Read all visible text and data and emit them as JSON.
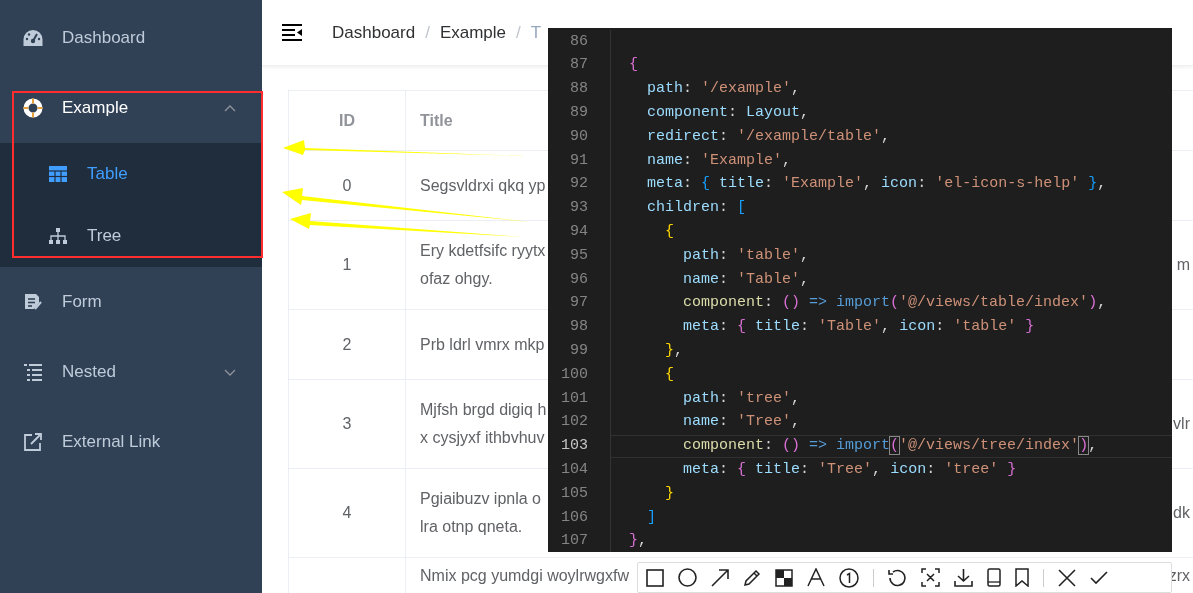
{
  "sidebar": {
    "items": [
      {
        "label": "Dashboard",
        "selected": false
      },
      {
        "label": "Example",
        "selected": false,
        "expanded": true,
        "children": [
          {
            "label": "Table",
            "selected": true
          },
          {
            "label": "Tree",
            "selected": false
          }
        ]
      },
      {
        "label": "Form",
        "selected": false
      },
      {
        "label": "Nested",
        "selected": false,
        "expanded": false
      },
      {
        "label": "External Link",
        "selected": false
      }
    ]
  },
  "breadcrumb": {
    "items": [
      "Dashboard",
      "Example",
      "T"
    ],
    "separators": [
      "/",
      "/"
    ]
  },
  "table": {
    "columns": [
      "ID",
      "Title"
    ],
    "rows": [
      {
        "id": "0",
        "title_lines": [
          "Segsvldrxi qkq yp"
        ]
      },
      {
        "id": "1",
        "title_lines": [
          "Ery kdetfsifc ryytx",
          "ofaz ohgy."
        ],
        "title_end": "m"
      },
      {
        "id": "2",
        "title_lines": [
          "Prb ldrl vmrx mkp"
        ]
      },
      {
        "id": "3",
        "title_lines": [
          "Mjfsh brgd digiq h",
          "x cysjyxf ithbvhuv"
        ],
        "title_end": "vlr"
      },
      {
        "id": "4",
        "title_lines": [
          "Pgiaibuzv ipnla o",
          "lra otnp qneta."
        ],
        "title_end": "dk"
      },
      {
        "title_lines": [
          "Nmix pcg yumdgi woylrwgxfw"
        ],
        "title_end": "zrx"
      }
    ]
  },
  "code_editor": {
    "lines": [
      {
        "number": "86",
        "highlighted": false
      },
      {
        "number": "87",
        "highlighted": false,
        "tokens": [
          {
            "kind": "b2",
            "text": "  {"
          }
        ]
      },
      {
        "number": "88",
        "highlighted": false,
        "tokens": [
          {
            "kind": "key",
            "text": "    path"
          },
          {
            "kind": "punc",
            "text": ": "
          },
          {
            "kind": "str",
            "text": "'/example'"
          },
          {
            "kind": "punc",
            "text": ","
          }
        ]
      },
      {
        "number": "89",
        "highlighted": false,
        "tokens": [
          {
            "kind": "key",
            "text": "    component"
          },
          {
            "kind": "punc",
            "text": ": "
          },
          {
            "kind": "var",
            "text": "Layout"
          },
          {
            "kind": "punc",
            "text": ","
          }
        ]
      },
      {
        "number": "90",
        "highlighted": false,
        "tokens": [
          {
            "kind": "key",
            "text": "    redirect"
          },
          {
            "kind": "punc",
            "text": ": "
          },
          {
            "kind": "str",
            "text": "'/example/table'"
          },
          {
            "kind": "punc",
            "text": ","
          }
        ]
      },
      {
        "number": "91",
        "highlighted": false,
        "tokens": [
          {
            "kind": "key",
            "text": "    name"
          },
          {
            "kind": "punc",
            "text": ": "
          },
          {
            "kind": "str",
            "text": "'Example'"
          },
          {
            "kind": "punc",
            "text": ","
          }
        ]
      },
      {
        "number": "92",
        "highlighted": false,
        "tokens": [
          {
            "kind": "key",
            "text": "    meta"
          },
          {
            "kind": "punc",
            "text": ": "
          },
          {
            "kind": "b3",
            "text": "{"
          },
          {
            "kind": "key",
            "text": " title"
          },
          {
            "kind": "punc",
            "text": ": "
          },
          {
            "kind": "str",
            "text": "'Example'"
          },
          {
            "kind": "punc",
            "text": ", "
          },
          {
            "kind": "key",
            "text": "icon"
          },
          {
            "kind": "punc",
            "text": ": "
          },
          {
            "kind": "str",
            "text": "'el-icon-s-help'"
          },
          {
            "kind": "b3",
            "text": " }"
          },
          {
            "kind": "punc",
            "text": ","
          }
        ]
      },
      {
        "number": "93",
        "highlighted": false,
        "tokens": [
          {
            "kind": "key",
            "text": "    children"
          },
          {
            "kind": "punc",
            "text": ": "
          },
          {
            "kind": "b3",
            "text": "["
          }
        ]
      },
      {
        "number": "94",
        "highlighted": false,
        "tokens": [
          {
            "kind": "b1",
            "text": "      {"
          }
        ]
      },
      {
        "number": "95",
        "highlighted": false,
        "tokens": [
          {
            "kind": "key",
            "text": "        path"
          },
          {
            "kind": "punc",
            "text": ": "
          },
          {
            "kind": "str",
            "text": "'table'"
          },
          {
            "kind": "punc",
            "text": ","
          }
        ]
      },
      {
        "number": "96",
        "highlighted": false,
        "tokens": [
          {
            "kind": "key",
            "text": "        name"
          },
          {
            "kind": "punc",
            "text": ": "
          },
          {
            "kind": "str",
            "text": "'Table'"
          },
          {
            "kind": "punc",
            "text": ","
          }
        ]
      },
      {
        "number": "97",
        "highlighted": false,
        "tokens": [
          {
            "kind": "fn",
            "text": "        component"
          },
          {
            "kind": "punc",
            "text": ": "
          },
          {
            "kind": "b2",
            "text": "()"
          },
          {
            "kind": "kw",
            "text": " => import"
          },
          {
            "kind": "b2",
            "text": "("
          },
          {
            "kind": "str",
            "text": "'@/views/table/index'"
          },
          {
            "kind": "b2",
            "text": ")"
          },
          {
            "kind": "punc",
            "text": ","
          }
        ]
      },
      {
        "number": "98",
        "highlighted": false,
        "tokens": [
          {
            "kind": "key",
            "text": "        meta"
          },
          {
            "kind": "punc",
            "text": ": "
          },
          {
            "kind": "b2",
            "text": "{"
          },
          {
            "kind": "key",
            "text": " title"
          },
          {
            "kind": "punc",
            "text": ": "
          },
          {
            "kind": "str",
            "text": "'Table'"
          },
          {
            "kind": "punc",
            "text": ", "
          },
          {
            "kind": "key",
            "text": "icon"
          },
          {
            "kind": "punc",
            "text": ": "
          },
          {
            "kind": "str",
            "text": "'table'"
          },
          {
            "kind": "b2",
            "text": " }"
          }
        ]
      },
      {
        "number": "99",
        "highlighted": false,
        "tokens": [
          {
            "kind": "b1",
            "text": "      }"
          },
          {
            "kind": "punc",
            "text": ","
          }
        ]
      },
      {
        "number": "100",
        "highlighted": false,
        "tokens": [
          {
            "kind": "b1",
            "text": "      {"
          }
        ]
      },
      {
        "number": "101",
        "highlighted": false,
        "tokens": [
          {
            "kind": "key",
            "text": "        path"
          },
          {
            "kind": "punc",
            "text": ": "
          },
          {
            "kind": "str",
            "text": "'tree'"
          },
          {
            "kind": "punc",
            "text": ","
          }
        ]
      },
      {
        "number": "102",
        "highlighted": false,
        "tokens": [
          {
            "kind": "key",
            "text": "        name"
          },
          {
            "kind": "punc",
            "text": ": "
          },
          {
            "kind": "str",
            "text": "'Tree'"
          },
          {
            "kind": "punc",
            "text": ","
          }
        ]
      },
      {
        "number": "103",
        "highlighted": true,
        "tokens": [
          {
            "kind": "fn",
            "text": "        component"
          },
          {
            "kind": "punc",
            "text": ": "
          },
          {
            "kind": "b2",
            "text": "()"
          },
          {
            "kind": "kw",
            "text": " => import"
          },
          {
            "kind": "match",
            "text": "("
          },
          {
            "kind": "str",
            "text": "'@/views/tree/index'"
          },
          {
            "kind": "match",
            "text": ")"
          },
          {
            "kind": "punc",
            "text": ","
          }
        ]
      },
      {
        "number": "104",
        "highlighted": false,
        "tokens": [
          {
            "kind": "key",
            "text": "        meta"
          },
          {
            "kind": "punc",
            "text": ": "
          },
          {
            "kind": "b2",
            "text": "{"
          },
          {
            "kind": "key",
            "text": " title"
          },
          {
            "kind": "punc",
            "text": ": "
          },
          {
            "kind": "str",
            "text": "'Tree'"
          },
          {
            "kind": "punc",
            "text": ", "
          },
          {
            "kind": "key",
            "text": "icon"
          },
          {
            "kind": "punc",
            "text": ": "
          },
          {
            "kind": "str",
            "text": "'tree'"
          },
          {
            "kind": "b2",
            "text": " }"
          }
        ]
      },
      {
        "number": "105",
        "highlighted": false,
        "tokens": [
          {
            "kind": "b1",
            "text": "      }"
          }
        ]
      },
      {
        "number": "106",
        "highlighted": false,
        "tokens": [
          {
            "kind": "b3",
            "text": "    ]"
          }
        ]
      },
      {
        "number": "107",
        "highlighted": false,
        "tokens": [
          {
            "kind": "b2",
            "text": "  }"
          },
          {
            "kind": "punc",
            "text": ","
          }
        ]
      }
    ]
  }
}
